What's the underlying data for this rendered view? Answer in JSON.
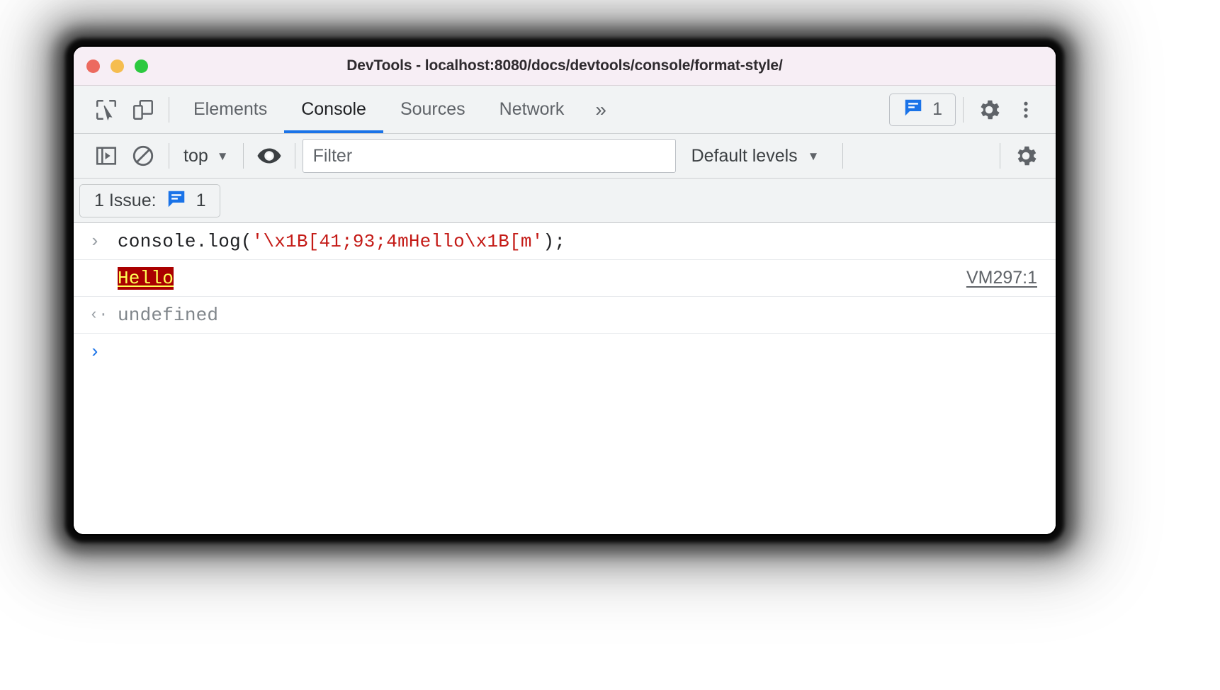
{
  "window": {
    "title": "DevTools - localhost:8080/docs/devtools/console/format-style/",
    "traffic_lights": [
      "close",
      "minimize",
      "maximize"
    ],
    "colors": {
      "close": "#ec6a5f",
      "minimize": "#f5bd4f",
      "maximize": "#2cc93f",
      "titlebar_bg": "#f7eef5",
      "accent": "#1a73e8",
      "issue_blue": "#1a73e8",
      "ansi_bg": "#aa0000",
      "ansi_fg": "#ffff55",
      "string_red": "#c41a16"
    }
  },
  "tabbar": {
    "inspect_icon": "inspect-cursor-icon",
    "device_icon": "device-toolbar-icon",
    "tabs": [
      {
        "label": "Elements",
        "active": false
      },
      {
        "label": "Console",
        "active": true
      },
      {
        "label": "Sources",
        "active": false
      },
      {
        "label": "Network",
        "active": false
      }
    ],
    "more_tabs_label": "»",
    "issues_chip": {
      "icon": "issue-speech-bubble-icon",
      "count": "1"
    },
    "settings_icon": "gear-icon",
    "more_options_icon": "kebab-menu-icon"
  },
  "console_toolbar": {
    "sidebar_toggle_icon": "console-sidebar-icon",
    "clear_console_icon": "clear-console-icon",
    "context_selector": {
      "value": "top",
      "caret": "▼"
    },
    "live_expression_icon": "eye-icon",
    "filter": {
      "placeholder": "Filter",
      "value": ""
    },
    "levels_selector": {
      "value": "Default levels",
      "caret": "▼"
    },
    "settings_icon": "console-settings-gear-icon"
  },
  "issues_bar": {
    "label": "1 Issue:",
    "icon": "issue-speech-bubble-icon",
    "count": "1"
  },
  "console": {
    "rows": [
      {
        "type": "input",
        "gutter": "›",
        "code_prefix": "console.log(",
        "code_string": "'\\x1B[41;93;4mHello\\x1B[m'",
        "code_suffix": ");"
      },
      {
        "type": "output",
        "gutter": "",
        "text": "Hello",
        "source": "VM297:1"
      },
      {
        "type": "result",
        "gutter": "‹·",
        "text": "undefined"
      }
    ],
    "prompt": "›"
  }
}
